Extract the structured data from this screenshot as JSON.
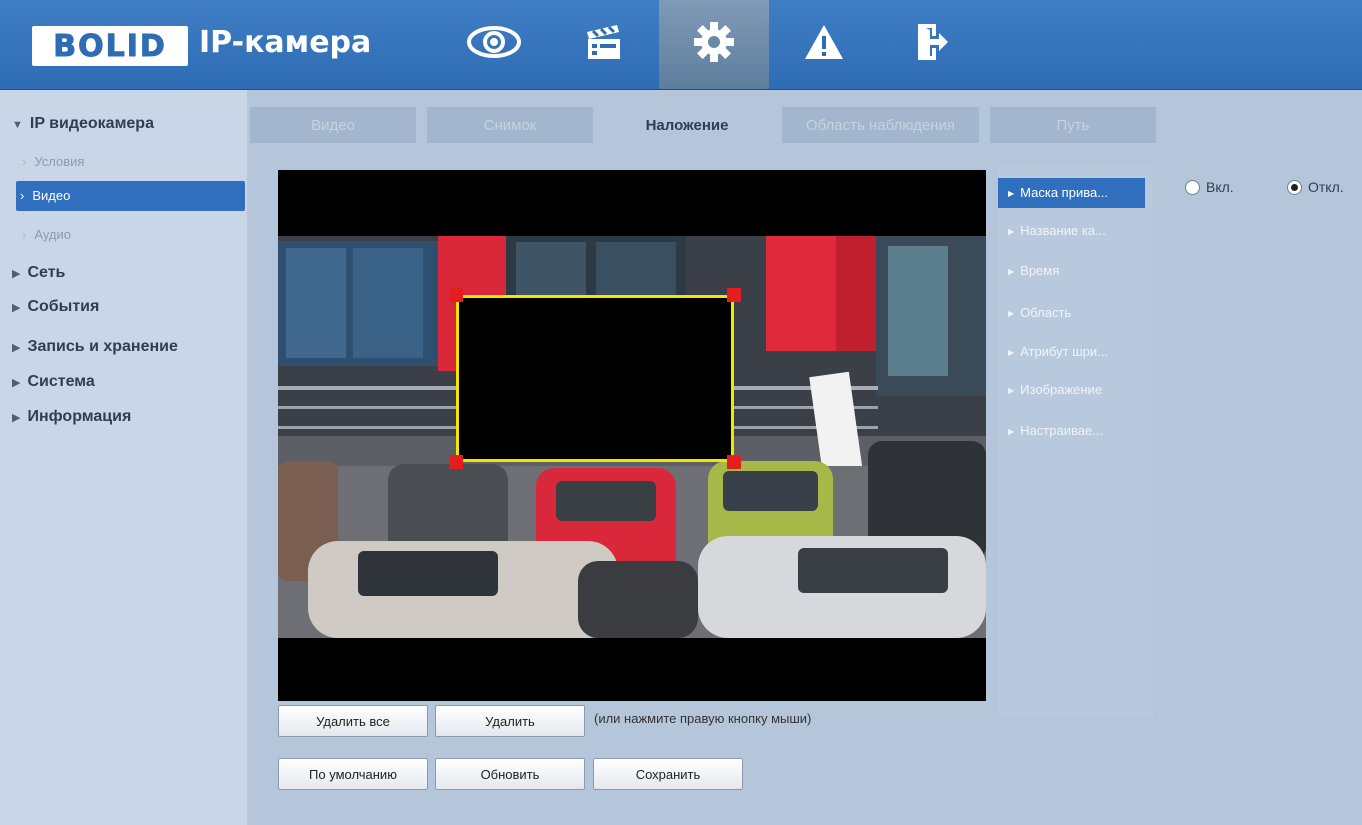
{
  "app": {
    "logo_text": "BOLID",
    "title": "IP-камера"
  },
  "topnav": {
    "items": [
      {
        "icon": "eye-icon"
      },
      {
        "icon": "clapperboard-icon"
      },
      {
        "icon": "gear-icon",
        "active": true
      },
      {
        "icon": "warning-icon"
      },
      {
        "icon": "logout-icon"
      }
    ]
  },
  "sidebar": {
    "ip_camera": "IP видеокамера",
    "conditions": "Условия",
    "video": "Видео",
    "audio": "Аудио",
    "network": "Сеть",
    "events": "События",
    "record": "Запись и хранение",
    "system": "Система",
    "info": "Информация"
  },
  "tabs": {
    "video": "Видео",
    "snapshot": "Снимок",
    "overlay": "Наложение",
    "observation": "Область наблюдения",
    "path": "Путь"
  },
  "overlay_menu": {
    "privacy_mask": "Маска прива...",
    "channel_name": "Название ка...",
    "time": "Время",
    "area": "Область",
    "font_attr": "Атрибут шри...",
    "image": "Изображение",
    "custom": "Настраивае..."
  },
  "radio": {
    "on": "Вкл.",
    "off": "Откл.",
    "selected": "off"
  },
  "buttons": {
    "delete_all": "Удалить все",
    "delete": "Удалить",
    "hint": "(или нажмите правую кнопку мыши)",
    "default": "По умолчанию",
    "refresh": "Обновить",
    "save": "Сохранить"
  },
  "colors": {
    "header": "#3472bb",
    "accent": "#2f6fbd",
    "mask_border": "#f2e600",
    "mask_handle": "#e41e1e"
  }
}
